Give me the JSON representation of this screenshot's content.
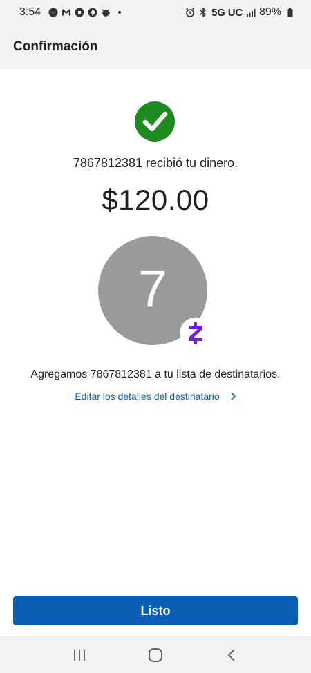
{
  "status_bar": {
    "time": "3:54",
    "network": "5G UC",
    "battery": "89%",
    "icons": [
      "messenger-icon",
      "gmail-icon",
      "chase-icon",
      "app-icon",
      "bug-icon",
      "alarm-icon",
      "bluetooth-icon",
      "signal-icon",
      "battery-icon"
    ]
  },
  "header": {
    "title": "Confirmación"
  },
  "confirmation": {
    "message": "7867812381 recibió tu dinero.",
    "amount": "$120.00",
    "avatar_initial": "7",
    "added_message": "Agregamos 7867812381 a tu lista de destinatarios.",
    "edit_link_label": "Editar los detalles del destinatario"
  },
  "actions": {
    "done_label": "Listo"
  },
  "colors": {
    "success_green": "#1f8a1f",
    "link_blue": "#1a5a9a",
    "button_blue": "#0a5fb4",
    "avatar_gray": "#9a9a9a",
    "zelle_purple": "#6d1ed4"
  }
}
